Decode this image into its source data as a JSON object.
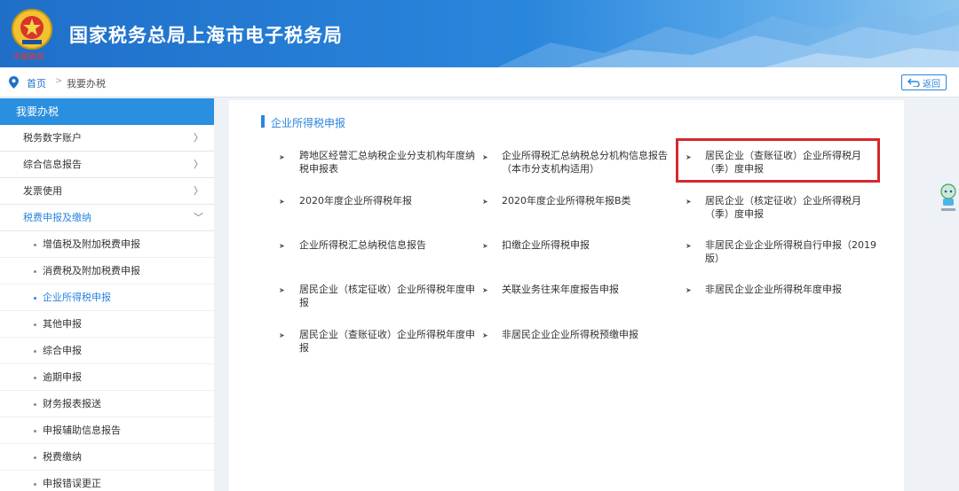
{
  "header": {
    "title": "国家税务总局上海市电子税务局",
    "emblem_text": "中国税务"
  },
  "breadcrumb": {
    "home": "首页",
    "separator": ">",
    "current": "我要办税"
  },
  "back_button": {
    "label": "返回",
    "icon": "return-arrow-icon"
  },
  "sidebar": {
    "heading": "我要办税",
    "items": [
      {
        "label": "税务数字账户",
        "chevron": "〉"
      },
      {
        "label": "综合信息报告",
        "chevron": "〉"
      },
      {
        "label": "发票使用",
        "chevron": "〉"
      },
      {
        "label": "税费申报及缴纳",
        "chevron": "﹀"
      }
    ],
    "subitems": [
      {
        "label": "增值税及附加税费申报"
      },
      {
        "label": "消费税及附加税费申报"
      },
      {
        "label": "企业所得税申报"
      },
      {
        "label": "其他申报"
      },
      {
        "label": "综合申报"
      },
      {
        "label": "逾期申报"
      },
      {
        "label": "财务报表报送"
      },
      {
        "label": "申报辅助信息报告"
      },
      {
        "label": "税费缴纳"
      },
      {
        "label": "申报错误更正"
      }
    ]
  },
  "main": {
    "section_title": "企业所得税申报",
    "bullet": "➤",
    "links": [
      {
        "l1": "跨地区经营汇总纳税企业分支机构年度纳",
        "l2": "税申报表"
      },
      {
        "l1": "企业所得税汇总纳税总分机构信息报告",
        "l2": "（本市分支机构适用）"
      },
      {
        "l1": "居民企业（查账征收）企业所得税月",
        "l2": "（季）度申报"
      },
      {
        "l1": "2020年度企业所得税年报",
        "l2": ""
      },
      {
        "l1": "2020年度企业所得税年报B类",
        "l2": ""
      },
      {
        "l1": "居民企业（核定征收）企业所得税月",
        "l2": "（季）度申报"
      },
      {
        "l1": "企业所得税汇总纳税信息报告",
        "l2": ""
      },
      {
        "l1": "扣缴企业所得税申报",
        "l2": ""
      },
      {
        "l1": "非居民企业企业所得税自行申报（2019",
        "l2": "版）"
      },
      {
        "l1": "居民企业（核定征收）企业所得税年度申",
        "l2": "报"
      },
      {
        "l1": "关联业务往来年度报告申报",
        "l2": ""
      },
      {
        "l1": "非居民企业企业所得税年度申报",
        "l2": ""
      },
      {
        "l1": "居民企业（查账征收）企业所得税年度申",
        "l2": "报"
      },
      {
        "l1": "非居民企业企业所得税预缴申报",
        "l2": ""
      }
    ]
  },
  "colors": {
    "accent": "#2a86dc",
    "highlight": "#d6282b",
    "header": "#1f6fc9"
  }
}
